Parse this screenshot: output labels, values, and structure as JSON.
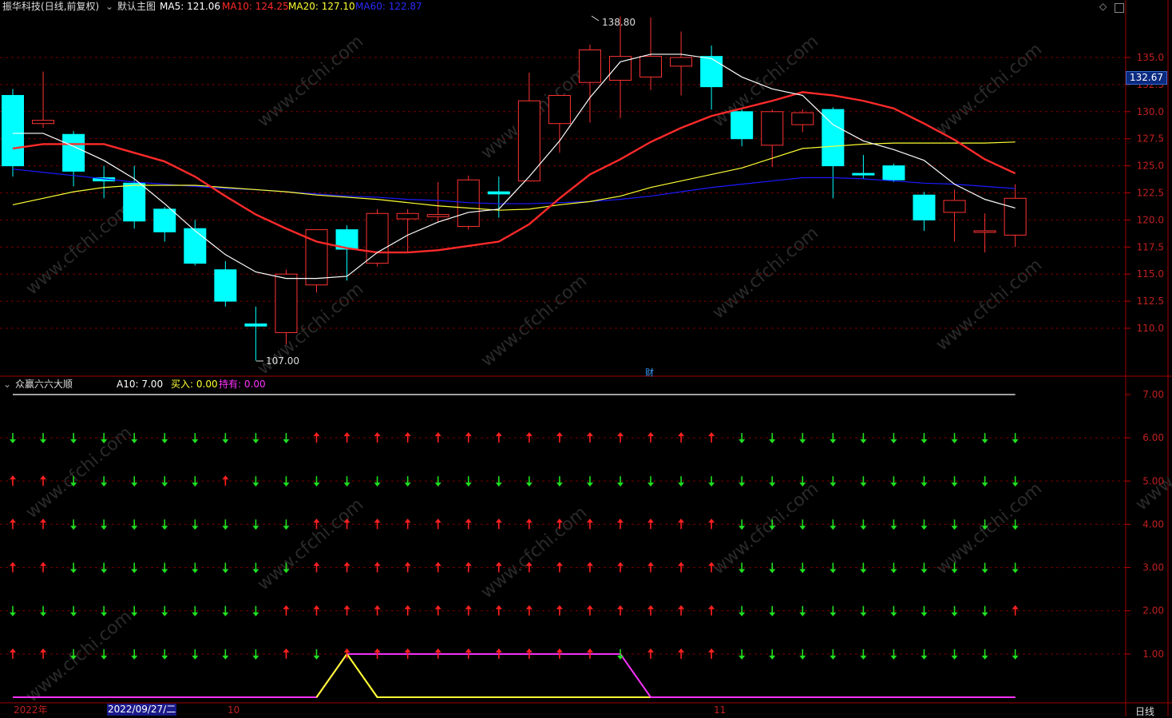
{
  "header": {
    "stock_name": "振华科技",
    "period_type": "(日线,前复权)",
    "main_chart": "默认主图",
    "ma5": {
      "label": "MA5:",
      "value": "121.06",
      "color": "#ffffff"
    },
    "ma10": {
      "label": "MA10:",
      "value": "124.25",
      "color": "#ff2a2a"
    },
    "ma20": {
      "label": "MA20:",
      "value": "127.10",
      "color": "#ffff33"
    },
    "ma60": {
      "label": "MA60:",
      "value": "122.87",
      "color": "#1a1aff"
    }
  },
  "price_axis": {
    "ticks": [
      "135.0",
      "132.5",
      "130.0",
      "127.5",
      "125.0",
      "122.5",
      "120.0",
      "117.5",
      "115.0",
      "112.5",
      "110.0"
    ],
    "current_price": "132.67"
  },
  "annotations": {
    "high": "138.80",
    "low": "107.00",
    "fin_marker": "财"
  },
  "indicator": {
    "name": "众赢六六大顺",
    "a10": {
      "label": "A10:",
      "value": "7.00"
    },
    "buy": {
      "label": "买入:",
      "value": "0.00",
      "color": "#ffff33"
    },
    "hold": {
      "label": "持有:",
      "value": "0.00",
      "color": "#ff33ff"
    },
    "ticks": [
      "7.00",
      "6.00",
      "5.00",
      "4.00",
      "3.00",
      "2.00",
      "1.00"
    ]
  },
  "time_axis": {
    "year": "2022年",
    "date": "2022/09/27/二",
    "month_oct": "10",
    "month_nov": "11",
    "period": "日线"
  },
  "colors": {
    "up": "#ff3333",
    "down": "#00ffff",
    "arrow_up": "#ff2020",
    "arrow_down": "#20e020",
    "grid": "#7a0000"
  },
  "chart_data": {
    "type": "candlestick",
    "ohlc": [
      [
        131.5,
        132.1,
        124.0,
        125.0
      ],
      [
        128.9,
        133.7,
        128.5,
        129.2
      ],
      [
        127.9,
        128.2,
        123.1,
        124.5
      ],
      [
        123.9,
        125.0,
        122.0,
        123.6
      ],
      [
        123.4,
        125.0,
        119.2,
        119.9
      ],
      [
        121.0,
        121.2,
        118.0,
        118.9
      ],
      [
        119.2,
        120.0,
        115.8,
        116.0
      ],
      [
        115.4,
        116.2,
        112.0,
        112.5
      ],
      [
        110.4,
        112.0,
        107.0,
        110.2
      ],
      [
        109.6,
        115.4,
        108.5,
        115.0
      ],
      [
        114.0,
        119.0,
        113.3,
        119.1
      ],
      [
        119.1,
        119.5,
        114.4,
        117.3
      ],
      [
        116.0,
        121.0,
        115.7,
        120.6
      ],
      [
        120.1,
        121.0,
        117.0,
        120.6
      ],
      [
        120.3,
        123.5,
        119.8,
        120.5
      ],
      [
        119.4,
        124.1,
        119.1,
        123.7
      ],
      [
        122.6,
        124.0,
        120.2,
        122.4
      ],
      [
        123.6,
        133.6,
        123.6,
        131.0
      ],
      [
        128.9,
        131.2,
        126.2,
        131.5
      ],
      [
        132.7,
        136.2,
        129.0,
        135.7
      ],
      [
        132.9,
        138.8,
        129.4,
        135.1
      ],
      [
        133.2,
        138.7,
        132.0,
        135.1
      ],
      [
        134.2,
        137.4,
        131.5,
        135.0
      ],
      [
        135.1,
        136.1,
        130.2,
        132.3
      ],
      [
        130.0,
        130.2,
        126.8,
        127.5
      ],
      [
        126.9,
        130.2,
        124.9,
        130.0
      ],
      [
        128.8,
        130.2,
        128.1,
        129.9
      ],
      [
        130.2,
        130.4,
        122.0,
        125.0
      ],
      [
        124.3,
        126.0,
        123.8,
        124.2
      ],
      [
        125.0,
        125.2,
        123.5,
        123.7
      ],
      [
        122.3,
        122.6,
        119.0,
        120.0
      ],
      [
        120.7,
        122.8,
        118.0,
        121.8
      ],
      [
        119.0,
        120.6,
        117.0,
        119.0
      ],
      [
        118.6,
        123.3,
        117.5,
        122.0
      ]
    ],
    "ma5": [
      128.0,
      128.0,
      126.8,
      125.5,
      123.8,
      121.5,
      119.0,
      116.8,
      115.2,
      114.6,
      114.6,
      114.8,
      117.0,
      118.6,
      119.8,
      120.7,
      121.0,
      124.0,
      127.3,
      131.3,
      134.6,
      135.3,
      135.3,
      134.9,
      133.2,
      132.1,
      131.5,
      128.8,
      127.3,
      126.5,
      125.5,
      123.3,
      121.9,
      121.1
    ],
    "ma10": [
      126.6,
      127.0,
      127.0,
      127.0,
      126.2,
      125.4,
      124.0,
      122.2,
      120.5,
      119.2,
      118.0,
      117.4,
      117.0,
      117.0,
      117.2,
      117.6,
      118.0,
      119.6,
      122.0,
      124.2,
      125.6,
      127.2,
      128.5,
      129.6,
      130.3,
      131.0,
      131.8,
      131.5,
      131.0,
      130.3,
      128.9,
      127.4,
      125.6,
      124.3
    ],
    "ma20": [
      121.4,
      122.0,
      122.6,
      123.0,
      123.2,
      123.2,
      123.2,
      123.0,
      122.8,
      122.6,
      122.3,
      122.1,
      121.9,
      121.6,
      121.3,
      121.1,
      120.9,
      121.0,
      121.4,
      121.7,
      122.2,
      123.0,
      123.6,
      124.2,
      124.8,
      125.7,
      126.6,
      126.8,
      127.0,
      127.1,
      127.1,
      127.1,
      127.1,
      127.2
    ],
    "ma60": [
      124.7,
      124.4,
      124.1,
      123.8,
      123.5,
      123.3,
      123.1,
      122.9,
      122.8,
      122.6,
      122.4,
      122.2,
      122.1,
      121.9,
      121.8,
      121.6,
      121.5,
      121.5,
      121.6,
      121.7,
      121.9,
      122.2,
      122.6,
      123.0,
      123.3,
      123.6,
      123.9,
      123.9,
      123.8,
      123.6,
      123.4,
      123.3,
      123.1,
      122.9
    ],
    "signals": [
      [
        "d",
        "d",
        "d",
        "d",
        "d",
        "d",
        "d",
        "d",
        "d",
        "d",
        "u",
        "u",
        "u",
        "u",
        "u",
        "u",
        "u",
        "u",
        "u",
        "u",
        "u",
        "u",
        "u",
        "u",
        "d",
        "d",
        "d",
        "d",
        "d",
        "d",
        "d",
        "d",
        "d",
        "d"
      ],
      [
        "u",
        "u",
        "d",
        "d",
        "d",
        "d",
        "d",
        "u",
        "d",
        "d",
        "d",
        "d",
        "d",
        "d",
        "d",
        "d",
        "d",
        "d",
        "d",
        "d",
        "d",
        "d",
        "d",
        "d",
        "d",
        "d",
        "d",
        "d",
        "d",
        "d",
        "d",
        "d",
        "d",
        "d"
      ],
      [
        "u",
        "u",
        "d",
        "d",
        "d",
        "d",
        "d",
        "d",
        "d",
        "d",
        "u",
        "u",
        "u",
        "u",
        "u",
        "u",
        "u",
        "u",
        "u",
        "u",
        "u",
        "u",
        "u",
        "u",
        "d",
        "d",
        "d",
        "d",
        "d",
        "d",
        "d",
        "d",
        "d",
        "d"
      ],
      [
        "u",
        "u",
        "d",
        "d",
        "d",
        "d",
        "d",
        "d",
        "d",
        "d",
        "u",
        "u",
        "u",
        "u",
        "u",
        "u",
        "u",
        "u",
        "u",
        "u",
        "u",
        "u",
        "u",
        "u",
        "d",
        "d",
        "d",
        "d",
        "d",
        "d",
        "d",
        "d",
        "d",
        "d"
      ],
      [
        "d",
        "d",
        "d",
        "d",
        "d",
        "d",
        "d",
        "d",
        "d",
        "u",
        "u",
        "u",
        "u",
        "u",
        "u",
        "u",
        "u",
        "u",
        "u",
        "u",
        "u",
        "u",
        "u",
        "u",
        "d",
        "d",
        "d",
        "d",
        "d",
        "d",
        "d",
        "d",
        "d",
        "u"
      ],
      [
        "u",
        "u",
        "d",
        "d",
        "d",
        "d",
        "d",
        "d",
        "d",
        "u",
        "d",
        "u",
        "u",
        "u",
        "u",
        "u",
        "u",
        "u",
        "u",
        "u",
        "d",
        "u",
        "u",
        "u",
        "d",
        "d",
        "d",
        "d",
        "d",
        "d",
        "d",
        "d",
        "d",
        "d"
      ]
    ],
    "hold_line": [
      0,
      0,
      0,
      0,
      0,
      0,
      0,
      0,
      0,
      0,
      0,
      1,
      1,
      1,
      1,
      1,
      1,
      1,
      1,
      1,
      1,
      0,
      0,
      0,
      0,
      0,
      0,
      0,
      0,
      0,
      0,
      0,
      0,
      0
    ],
    "buy_line": [
      0,
      0,
      0,
      0,
      0,
      0,
      0,
      0,
      0,
      0,
      0,
      1,
      0,
      0,
      0,
      0,
      0,
      0,
      0,
      0,
      0,
      0,
      0,
      0,
      0,
      0,
      0,
      0,
      0,
      0,
      0,
      0,
      0,
      0
    ],
    "a10_line_value": 7,
    "ylim_price": [
      107,
      139.5
    ],
    "ylim_indicator": [
      0,
      7
    ]
  }
}
